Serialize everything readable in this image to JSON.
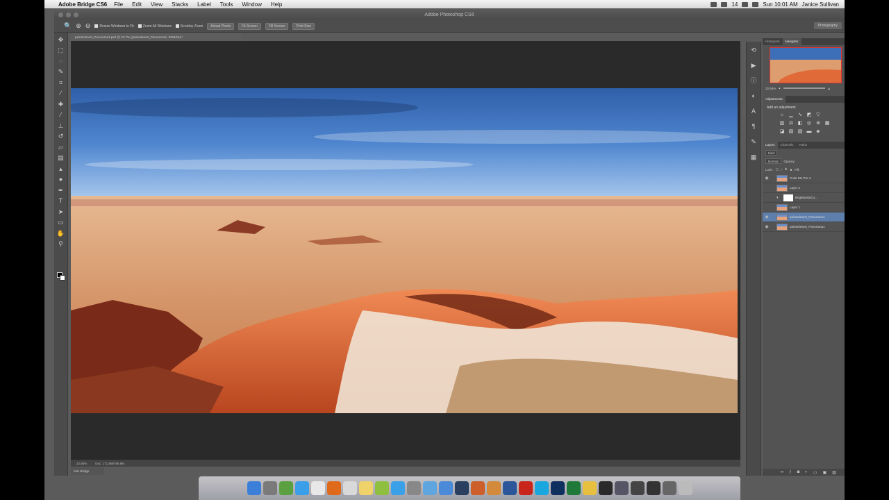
{
  "menubar": {
    "app_name": "Adobe Bridge CS6",
    "items": [
      "File",
      "Edit",
      "View",
      "Stacks",
      "Label",
      "Tools",
      "Window",
      "Help"
    ],
    "battery": "14",
    "clock": "Sun 10:01 AM",
    "user": "Janice Sullivan"
  },
  "window": {
    "title": "Adobe Photoshop CS6"
  },
  "options_bar": {
    "resize_windows": "Resize Windows to Fit",
    "zoom_all": "Zoom All Windows",
    "scrubby_zoom": "Scrubby Zoom",
    "actual_pixels": "Actual Pixels",
    "fit_screen": "Fit Screen",
    "fill_screen": "Fill Screen",
    "print_size": "Print Size",
    "workspace": "Photography"
  },
  "document": {
    "tab_label": "paintedesert_Panorama1.psd @ 22.7% (paintedesert_Panorama1, RGB/16) *",
    "zoom": "22.68%",
    "doc_size": "Doc: 171.9M/766.9M",
    "mini_bridge": "Mini Bridge"
  },
  "panels": {
    "top_tabs": [
      "Histogram",
      "Navigator"
    ],
    "navigator_zoom": "22.68%",
    "adjust_tabs": [
      "Adjustments"
    ],
    "adjust_title": "Add an adjustment",
    "layer_tabs": [
      "Layers",
      "Channels",
      "Paths"
    ],
    "filter_kind": "Kind",
    "blend_mode": "Normal",
    "opacity_label": "Opacity:",
    "lock_label": "Lock:",
    "fill_label": "Fill:",
    "layers": [
      {
        "name": "Color Me Pro 4",
        "selected": false,
        "mask": false
      },
      {
        "name": "Layer 2",
        "selected": false,
        "mask": false
      },
      {
        "name": "Brightness/Co...",
        "selected": false,
        "mask": true
      },
      {
        "name": "Layer 1",
        "selected": false,
        "mask": false
      },
      {
        "name": "paintedesert_Panorama1",
        "selected": true,
        "mask": false
      },
      {
        "name": "paintedesert_Panorama1",
        "selected": false,
        "mask": false
      }
    ]
  },
  "dock": {
    "icons": [
      "finder-icon",
      "launchpad-icon",
      "preview-icon",
      "safari-icon",
      "calendar-icon",
      "firefox-icon",
      "chrome-icon",
      "notes-icon",
      "photos-icon",
      "app-store-icon",
      "system-preferences-icon",
      "itunes-icon",
      "folder-icon",
      "lightroom-icon",
      "app-icon",
      "app-icon-2",
      "word-icon",
      "acrobat-icon",
      "skype-icon",
      "photoshop-icon",
      "excel-icon",
      "app-icon-3",
      "bridge-icon",
      "app-icon-4",
      "app-icon-5",
      "app-icon-6",
      "app-icon-7",
      "trash-icon"
    ]
  }
}
